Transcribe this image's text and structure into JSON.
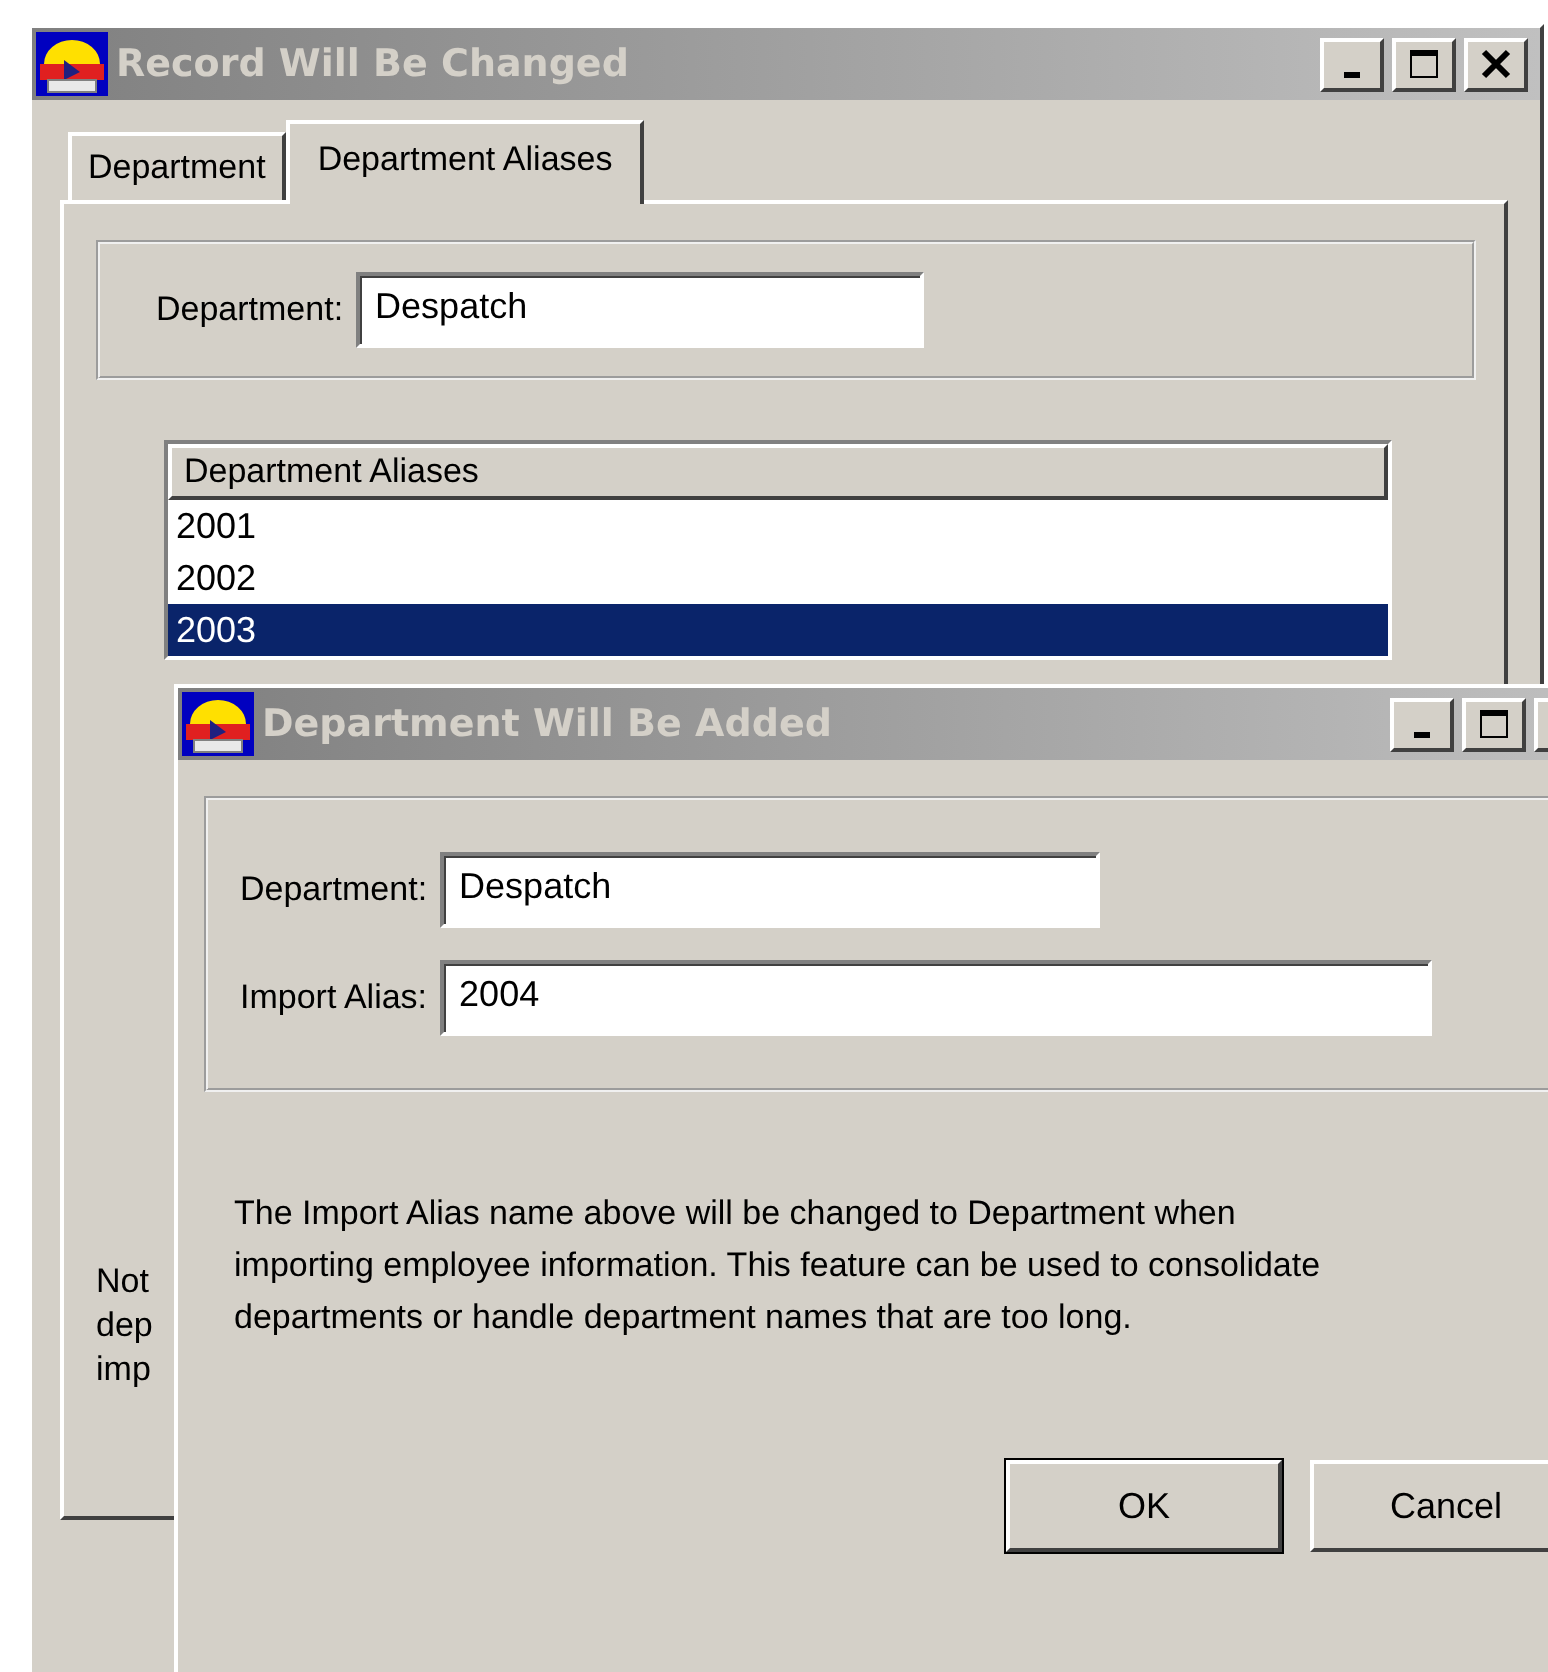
{
  "main_window": {
    "title": "Record Will Be Changed",
    "tabs": [
      {
        "label": "Department",
        "selected": false
      },
      {
        "label": "Department Aliases",
        "selected": true
      }
    ],
    "department": {
      "label": "Department:",
      "value": "Despatch"
    },
    "aliases_list": {
      "header": "Department Aliases",
      "rows": [
        {
          "text": "2001",
          "selected": false
        },
        {
          "text": "2002",
          "selected": false
        },
        {
          "text": "2003",
          "selected": true
        }
      ]
    },
    "note_lines": [
      "Not",
      "dep",
      "imp"
    ]
  },
  "dialog": {
    "title": "Department Will Be Added",
    "department": {
      "label": "Department:",
      "value": "Despatch"
    },
    "import_alias": {
      "label": "Import Alias:",
      "value": "2004"
    },
    "description": "The Import Alias name above will be changed to Department when importing employee information. This feature can be used to consolidate departments or handle department names that are too long.",
    "buttons": [
      {
        "label": "OK",
        "default": true
      },
      {
        "label": "Cancel",
        "default": false
      }
    ]
  }
}
